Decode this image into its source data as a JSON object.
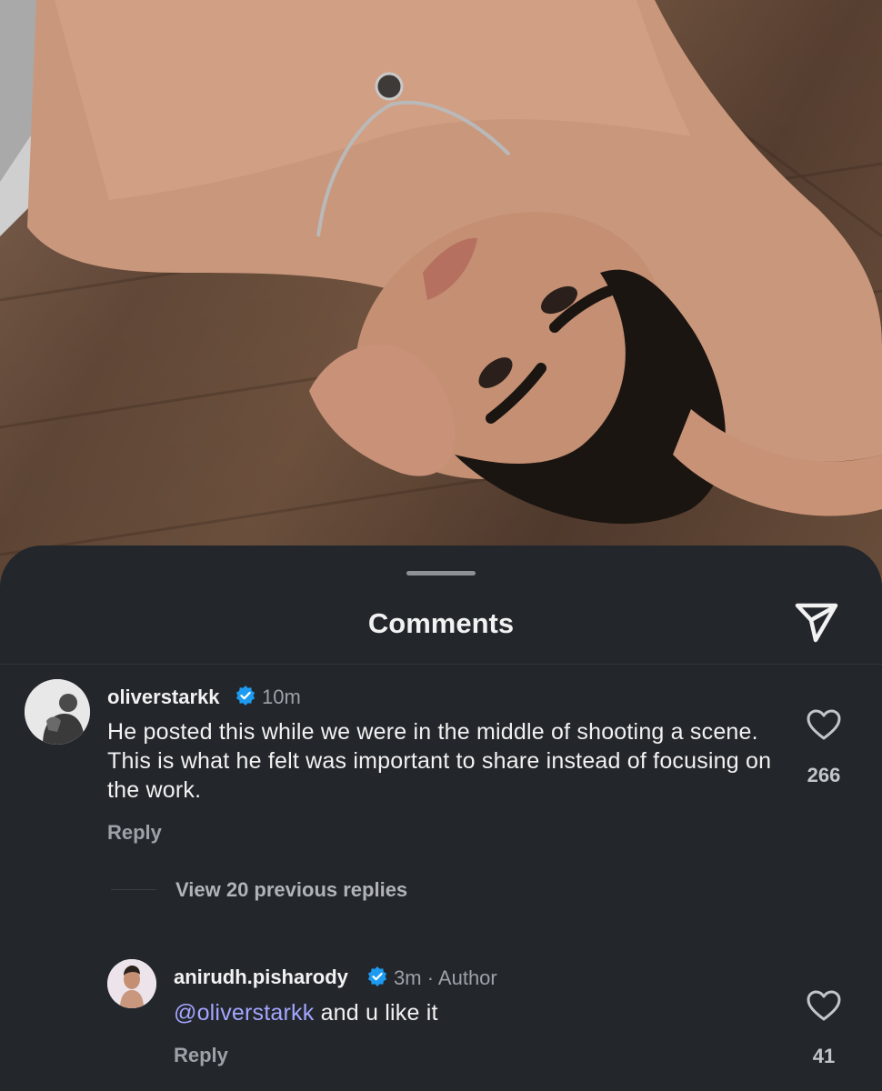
{
  "photo": {
    "image": "man-lying-on-wooden-floor-photo"
  },
  "sheet": {
    "title": "Comments",
    "share_icon": "paper-plane-icon"
  },
  "comments": [
    {
      "username": "oliverstarkk",
      "verified": true,
      "time": "10m",
      "text": "He posted this while we were in the middle of shooting a scene. This is what he felt was important to share instead of focusing on the work.",
      "reply_label": "Reply",
      "likes": "266"
    }
  ],
  "thread": {
    "view_replies_label": "View 20 previous replies"
  },
  "replies": [
    {
      "username": "anirudh.pisharody",
      "verified": true,
      "time": "3m",
      "separator": "·",
      "role": "Author",
      "mention": "@oliverstarkk",
      "text": "and u like it",
      "reply_label": "Reply",
      "likes": "41"
    }
  ],
  "colors": {
    "background": "#23262b",
    "verified_badge": "#1d9bf0",
    "mention": "#a3a6ff",
    "muted_text": "#9ea2a8"
  }
}
